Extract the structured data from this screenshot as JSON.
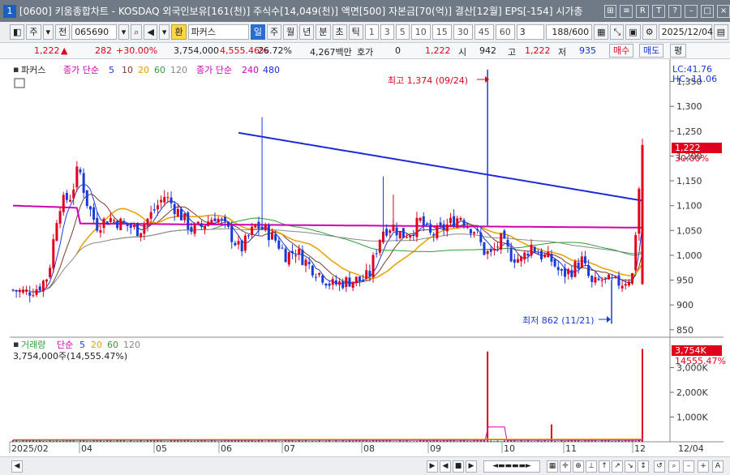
{
  "title": {
    "num": "1",
    "text": "[0600] 키움종합차트 - KOSDAQ 외국인보유[161(천)] 주식수[14,049(천)] 액면[500] 자본금[70(억)] 결산[12월] EPS[-154] 시가총",
    "buttons": [
      "⊞",
      "≡",
      "R",
      "T",
      "?",
      "–",
      "□",
      "×"
    ]
  },
  "toolbar": {
    "type": "주",
    "market": "전",
    "code": "065690",
    "checkmark": "환",
    "name": "파커스",
    "periods": [
      "일",
      "주",
      "월",
      "년",
      "분",
      "초",
      "틱"
    ],
    "intervals": [
      "1",
      "3",
      "5",
      "10",
      "15",
      "30",
      "45",
      "60"
    ],
    "custom": "3",
    "count": "188/600",
    "date": "2025/12/04"
  },
  "quote": {
    "price": "1,222",
    "arrow": "▲",
    "change": "282",
    "change_pct": "+30.00%",
    "volume": "3,754,000",
    "volume_pct": "4,555.46%",
    "turnover": "26.72%",
    "amount": "4,267백만",
    "hoga_label": "호가",
    "hoga": "0",
    "hoga2": "1,222",
    "open_label": "시",
    "open": "942",
    "high_label": "고",
    "high": "1,222",
    "low_label": "저",
    "low": "935",
    "buy": "매수",
    "sell": "매도",
    "avg": "평"
  },
  "legend": {
    "name": "파커스",
    "ma_label": "종가 단순",
    "ma_periods": [
      "5",
      "10",
      "20",
      "60",
      "120"
    ],
    "ma_label2": "종가 단순",
    "ma_periods2": [
      "240",
      "480"
    ],
    "lc": "LC:41.76",
    "hc": "HC:-11.06"
  },
  "vol_legend": {
    "label": "거래량",
    "ma_label": "단순",
    "periods": [
      "5",
      "20",
      "60",
      "120"
    ],
    "value": "3,754,000주(14,555.47%)"
  },
  "annotations": {
    "high": "최고 1,374 (09/24)",
    "low": "최저 862 (11/21)"
  },
  "price_tag": {
    "value": "1,222",
    "pct": "30.00%"
  },
  "vol_tag": {
    "value": "3,754K",
    "pct": "14555.47%"
  },
  "colors": {
    "up": "#e0001b",
    "down": "#1a3ad8",
    "ma5": "#1a3ad8",
    "ma10": "#7a3b2e",
    "ma20": "#e8a000",
    "ma60": "#2f9e3a",
    "ma120": "#888888",
    "ma240": "#d000b0",
    "ma480": "#1a2ad8"
  },
  "chart_data": {
    "type": "candlestick",
    "y_ticks": [
      1350,
      1300,
      1250,
      1200,
      1150,
      1100,
      1050,
      1000,
      950,
      900,
      850
    ],
    "vol_ticks": [
      "3,000K",
      "2,000K",
      "1,000K"
    ],
    "x_labels": [
      "2025/02",
      "04",
      "05",
      "06",
      "07",
      "08",
      "09",
      "10",
      "11",
      "12",
      "12/04"
    ],
    "ylim": [
      835,
      1395
    ],
    "high_value": 1374,
    "low_value": 862,
    "last_close": 1222,
    "last_volume": 3754000
  }
}
